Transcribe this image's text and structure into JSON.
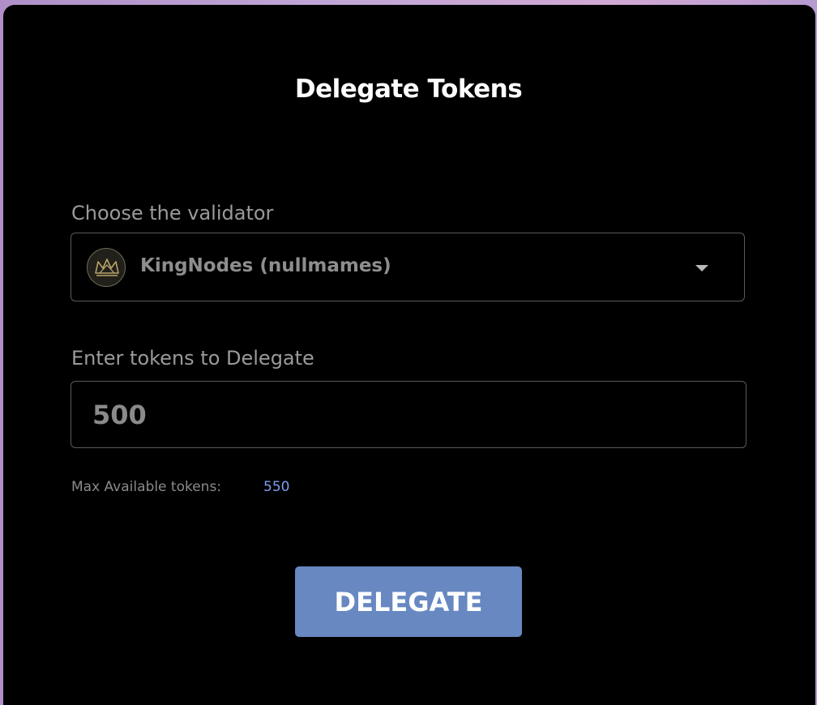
{
  "modal": {
    "title": "Delegate Tokens"
  },
  "validator": {
    "label": "Choose the validator",
    "selected": "KingNodes (nullmames)",
    "logo_icon": "crown-icon",
    "dropdown_icon": "caret-down-icon"
  },
  "tokens": {
    "label": "Enter tokens to Delegate",
    "value": "500",
    "max_label": "Max Available tokens:",
    "max_value": "550"
  },
  "actions": {
    "delegate_label": "DELEGATE"
  },
  "colors": {
    "accent_button": "#6888c2",
    "max_value": "#7d9bf2",
    "modal_bg": "#000000"
  }
}
